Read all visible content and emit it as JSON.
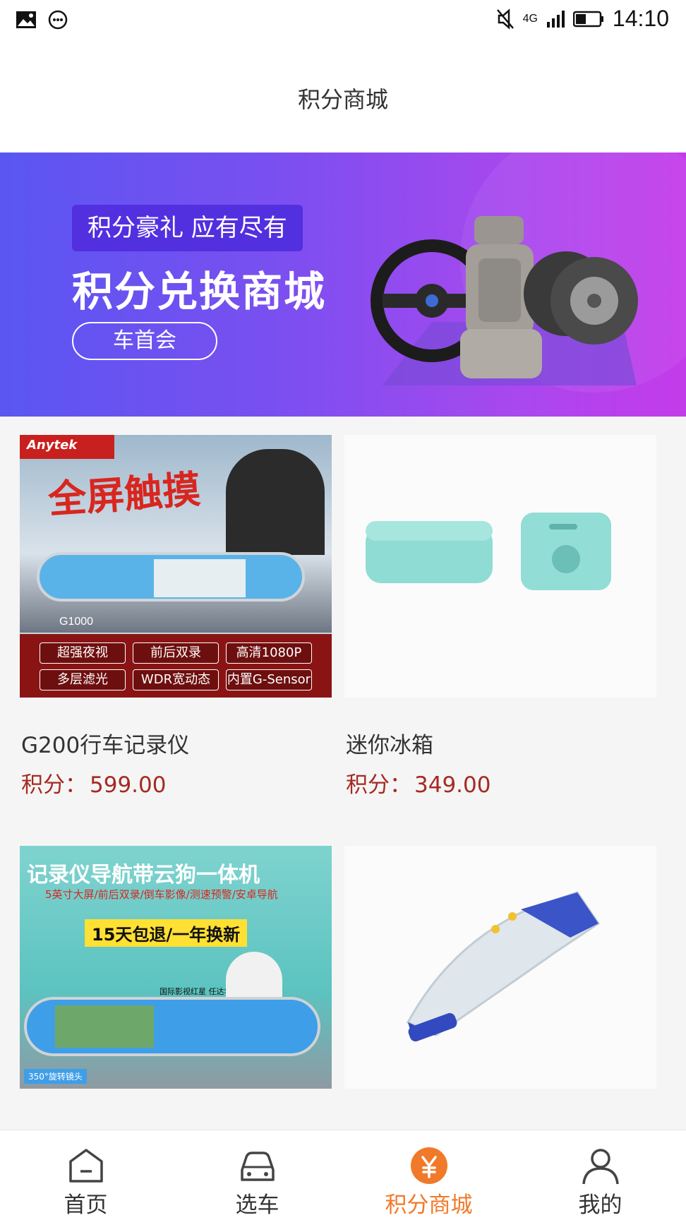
{
  "status_bar": {
    "time": "14:10",
    "network": "4G",
    "icons": [
      "image-icon",
      "message-icon",
      "mute-icon",
      "signal-icon",
      "battery-icon"
    ]
  },
  "header": {
    "title": "积分商城"
  },
  "banner": {
    "tagline": "积分豪礼 应有尽有",
    "headline": "积分兑换商城",
    "button_label": "车首会"
  },
  "products": [
    {
      "name": "G200行车记录仪",
      "price_label": "积分：",
      "price": "599.00",
      "image": {
        "brand": "Anytek",
        "slogan": "全屏触摸",
        "model": "G1000",
        "features": [
          "超强夜视",
          "前后双录",
          "高清1080P",
          "多层滤光",
          "WDR宽动态",
          "内置G-Sensor"
        ]
      }
    },
    {
      "name": "迷你冰箱",
      "price_label": "积分：",
      "price": "349.00",
      "image": {}
    },
    {
      "name": "",
      "price_label": "",
      "price": "",
      "image": {
        "headline": "记录仪导航带云狗一体机",
        "subline": "5英寸大屏/前后双录/倒车影像/测速预警/安卓导航",
        "promo": "15天包退/一年换新",
        "endorser": "国际影视红星 任达华",
        "corner": "350°旋转镜头"
      }
    },
    {
      "name": "",
      "price_label": "",
      "price": "",
      "image": {}
    }
  ],
  "tabbar": {
    "active_color": "#f07a2a",
    "tabs": [
      {
        "label": "首页",
        "icon": "home-icon"
      },
      {
        "label": "选车",
        "icon": "car-icon"
      },
      {
        "label": "积分商城",
        "icon": "points-mall-icon",
        "active": true
      },
      {
        "label": "我的",
        "icon": "profile-icon"
      }
    ]
  }
}
